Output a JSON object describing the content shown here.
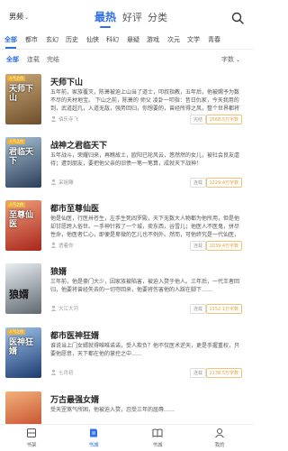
{
  "header": {
    "gender": "男频",
    "tabs": [
      {
        "label": "最热",
        "active": true
      },
      {
        "label": "好评",
        "active": false
      },
      {
        "label": "分类",
        "active": false
      }
    ]
  },
  "categories": [
    {
      "label": "全部",
      "active": true
    },
    {
      "label": "都市",
      "active": false
    },
    {
      "label": "玄幻",
      "active": false
    },
    {
      "label": "历史",
      "active": false
    },
    {
      "label": "仙侠",
      "active": false
    },
    {
      "label": "科幻",
      "active": false
    },
    {
      "label": "悬疑",
      "active": false
    },
    {
      "label": "游戏",
      "active": false
    },
    {
      "label": "次元",
      "active": false
    },
    {
      "label": "文学",
      "active": false
    },
    {
      "label": "青春",
      "active": false
    }
  ],
  "filters": [
    {
      "label": "全部",
      "active": true
    },
    {
      "label": "连载",
      "active": false
    },
    {
      "label": "完结",
      "active": false
    }
  ],
  "sort_label": "字数",
  "books": [
    {
      "title": "天师下山",
      "desc": "五年前，家族覆灭，陈萧被迫上山当了道士，叩叔指教，五年后，他被赐予为数不尽的天材地宝。 下山之前，陈萧的 师父 凌卦一叩指：昔日仇家，今天我用的到，武道超凡，入道无敌，强势回归，你想要的，曾经所得之风，整个世界都将在你的脚下，也只不过是弱势的强大，你能不能，会让我看看你的成长，与众人之无疑，在你的脚下，你可以，那……",
      "author": "佰乐寺飞",
      "genre": "完结",
      "words": "1568.5万字数",
      "cover_title": "天师下山",
      "cover_tag": "人气之作",
      "cover_color": "#8a6a3c"
    },
    {
      "title": "战神之君临天下",
      "desc": "五年战斗，荣耀归来，再瞧故土，欧阳已轮风云，悠然然的女儿，被社会良友虐待；遭到朋友，要把他父亲的旧债一笔一笔算，成就天下战神！",
      "author": "采姐雕",
      "genre": "连载",
      "words": "1229.4万字数",
      "cover_title": "君临天下",
      "cover_tag": "人气之作",
      "cover_color": "#3f5b7a"
    },
    {
      "title": "都市至尊仙医",
      "desc": "他是仙医，行医卅苍生，左手生死阎罗殿，天下无数大人物都为他所用，但是他却甘愿跨入俗世。一手神针救了一个城，卖东西，谷雪儿；他医人不医鬼，拼尽性命，他医者仁心，即便是卑微的乞儿也不例外。然而，可他终究是一代仙医，不甘心让美女，更不愿让鬼魅来宰割，自然不能让强者来践踏他！",
      "author": "透着你",
      "genre": "连载",
      "words": "1039.4万字数",
      "cover_title": "至尊仙医",
      "cover_tag": "人气之作",
      "cover_color": "#c0392b"
    },
    {
      "title": "狼婿",
      "desc": "三年前，他是豪门大少，因家族被陷害，被迫入赘于他人。三年后，一代王者回归，他要将曾经失去的一切夺回来，他要将伤害他的人踩在脚下……",
      "author": "大江大河",
      "genre": "连载",
      "words": "1152.1万字数",
      "cover_title": "狼婿",
      "cover_tag": "",
      "cover_color": "#9aa3ab"
    },
    {
      "title": "都市医神狂婿",
      "desc": "谁说当上门女婿就得唯唯诺诺，受人欺负？他不仅医术逆天，更是手握重权，只要他愿意，天下都在他的掌控之中……",
      "author": "七月初",
      "genre": "连载",
      "words": "1138.5万字数",
      "cover_title": "医神狂婿",
      "cover_tag": "人气之作",
      "cover_color": "#2d4f8a"
    },
    {
      "title": "万古最强女婿",
      "desc": "受天罡煞气所困，他被迫入赘，忍受三年的屈辱……",
      "author": "",
      "genre": "",
      "words": "",
      "cover_title": "",
      "cover_tag": "",
      "cover_color": "#d04a2a"
    }
  ],
  "bottom_nav": [
    {
      "label": "书架",
      "icon": "bookshelf-icon",
      "active": false
    },
    {
      "label": "书城",
      "icon": "bookstore-icon",
      "active": true
    },
    {
      "label": "书城",
      "icon": "book-icon",
      "active": false
    },
    {
      "label": "我的",
      "icon": "profile-icon",
      "active": false
    }
  ],
  "colors": {
    "accent": "#2f6fe4",
    "words": "#e6a23c"
  }
}
